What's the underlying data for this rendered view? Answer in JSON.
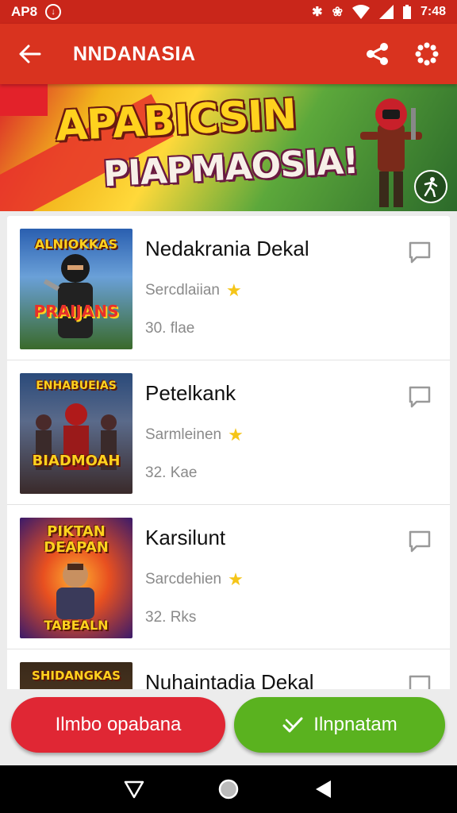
{
  "status_bar": {
    "left_text": "AP8",
    "time": "7:48",
    "bg_color": "#c9261a"
  },
  "app_bar": {
    "title": "NNDANASIA",
    "bg_color": "#d9331f",
    "icons": [
      "back-arrow-icon",
      "share-icon",
      "more-dots-icon"
    ]
  },
  "banner": {
    "title_line1": "APABICSIN",
    "title_line2": "PIAPMAOSIA!"
  },
  "games": [
    {
      "title": "Nedakrania Dekal",
      "subtitle": "Sercdlaiian",
      "size": "30. flae",
      "thumb_text_top": "ALNIOKKAS",
      "thumb_text_bottom": "PRAIJANS"
    },
    {
      "title": "Petelkank",
      "subtitle": "Sarmleinen",
      "size": "32. Kae",
      "thumb_text_top": "ENHABUEIAS",
      "thumb_text_bottom": "BIADMOAH"
    },
    {
      "title": "Karsilunt",
      "subtitle": "Sarcdehien",
      "size": "32. Rks",
      "thumb_text_top": "PIKTAN DEAPAN",
      "thumb_text_bottom": "TABEALN"
    },
    {
      "title": "Nuhaintadia Dekal",
      "subtitle": "",
      "size": "",
      "thumb_text_top": "SHIDANGKAS",
      "thumb_text_bottom": ""
    }
  ],
  "buttons": {
    "left_label": "Ilmbo opabana",
    "right_label": "Ilnpnatam",
    "left_color": "#e02734",
    "right_color": "#5ab21f"
  },
  "nav": {
    "icons": [
      "back-triangle-icon",
      "home-circle-icon",
      "recents-triangle-icon"
    ]
  }
}
